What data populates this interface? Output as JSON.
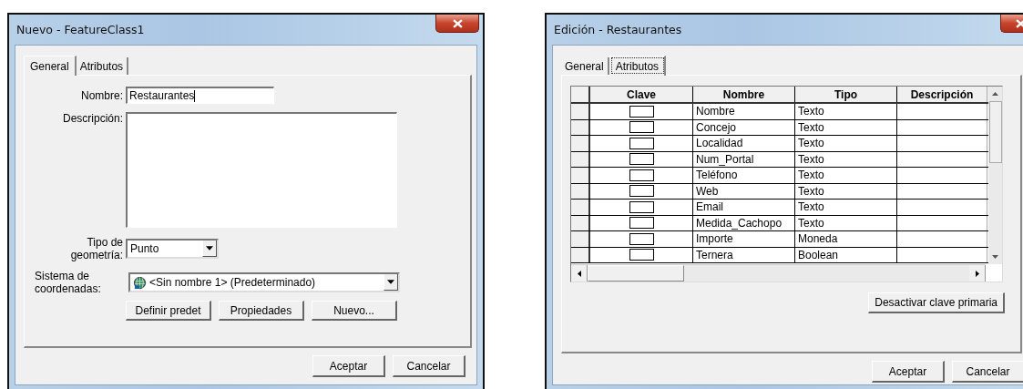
{
  "new_dialog": {
    "title": "Nuevo - FeatureClass1",
    "tabs": [
      {
        "label": "General",
        "selected": true
      },
      {
        "label": "Atributos",
        "selected": false
      }
    ],
    "name_label": "Nombre:",
    "name_value": "Restaurantes",
    "description_label": "Descripción:",
    "geometry_label": [
      "Tipo de",
      "geometría:"
    ],
    "geometry_value": "Punto",
    "crs_label": [
      "Sistema de",
      "coordenadas:"
    ],
    "crs_value": "<Sin nombre 1> (Predeterminado)",
    "crs_buttons": [
      "Definir predet",
      "Propiedades",
      "Nuevo..."
    ],
    "buttons": [
      "Aceptar",
      "Cancelar"
    ]
  },
  "edit_dialog": {
    "title": "Edición - Restaurantes",
    "tabs": [
      {
        "label": "General",
        "selected": false
      },
      {
        "label": "Atributos",
        "selected": true
      }
    ],
    "table": {
      "columns": [
        "Clave",
        "Nombre",
        "Tipo",
        "Descripción"
      ],
      "rows": [
        {
          "key": false,
          "name": "Nombre",
          "type": "Texto"
        },
        {
          "key": false,
          "name": "Concejo",
          "type": "Texto"
        },
        {
          "key": false,
          "name": "Localidad",
          "type": "Texto"
        },
        {
          "key": false,
          "name": "Num_Portal",
          "type": "Texto"
        },
        {
          "key": false,
          "name": "Teléfono",
          "type": "Texto"
        },
        {
          "key": false,
          "name": "Web",
          "type": "Texto"
        },
        {
          "key": false,
          "name": "Email",
          "type": "Texto"
        },
        {
          "key": false,
          "name": "Medida_Cachopo",
          "type": "Texto"
        },
        {
          "key": false,
          "name": "Importe",
          "type": "Moneda"
        },
        {
          "key": false,
          "name": "Ternera",
          "type": "Boolean"
        }
      ]
    },
    "primary_key_button": "Desactivar clave primaria",
    "buttons": [
      "Aceptar",
      "Cancelar"
    ]
  }
}
